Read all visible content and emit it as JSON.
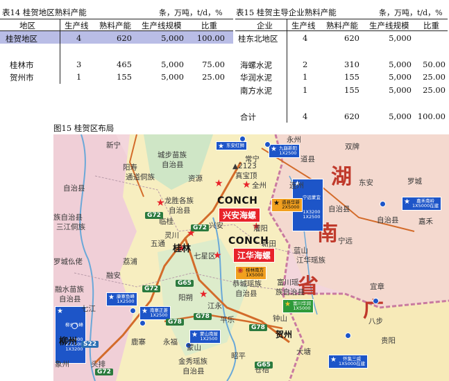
{
  "table14": {
    "title": "表14 桂贺地区熟料产能",
    "unit": "条，万吨，t/d，%",
    "headers": [
      "地区",
      "生产线",
      "熟料产能",
      "生产线规模",
      "比重"
    ],
    "rows": [
      [
        "桂贺地区",
        "4",
        "620",
        "5,000",
        "100.00"
      ],
      [
        "桂林市",
        "3",
        "465",
        "5,000",
        "75.00"
      ],
      [
        "贺州市",
        "1",
        "155",
        "5,000",
        "25.00"
      ]
    ]
  },
  "table15": {
    "title": "表15 桂贺主导企业熟料产能",
    "unit": "条，万吨，t/d，%",
    "headers": [
      "企业",
      "生产线",
      "熟料产能",
      "生产线规模",
      "比重"
    ],
    "rows": [
      [
        "桂东北地区",
        "4",
        "620",
        "5,000",
        ""
      ],
      [
        "海螺水泥",
        "2",
        "310",
        "5,000",
        "50.00"
      ],
      [
        "华润水泥",
        "1",
        "155",
        "5,000",
        "25.00"
      ],
      [
        "南方水泥",
        "1",
        "155",
        "5,000",
        "25.00"
      ],
      [
        "合计",
        "4",
        "620",
        "5,000",
        "100.00"
      ]
    ]
  },
  "figure": {
    "title": "图15 桂贺区布局",
    "province_labels": [
      "湖",
      "南",
      "省",
      "广"
    ],
    "conch_logo_text": [
      "CONCH",
      "CONCH"
    ],
    "plant_labels_red": [
      "兴安海螺",
      "江华海螺"
    ],
    "blue_boxes": [
      {
        "name": "东安红狮",
        "cap": ""
      },
      {
        "name": "九嶷新阳",
        "cap": "1X2500"
      },
      {
        "name": "宁远蒙宜",
        "cap": "1X3200\n1X2500"
      },
      {
        "name": "嘉禾南岭",
        "cap": "1X5000在建"
      },
      {
        "name": "康寨鱼峰",
        "cap": "1X2500"
      },
      {
        "name": "南寨正菱",
        "cap": "1X2500"
      },
      {
        "name": "柳州鱼峰",
        "cap": "1X2000\n2X2500\n1X3200"
      },
      {
        "name": "蒙山南屋",
        "cap": "1X2500"
      },
      {
        "name": "怀集三威",
        "cap": "1X5000在建"
      }
    ],
    "orange_boxes": [
      {
        "name": "道县华新",
        "cap": "2X5000"
      }
    ],
    "green_boxes": [
      {
        "name": "富川华润",
        "cap": "1X5000"
      }
    ],
    "orange_circle_box": {
      "name": "桂林南方",
      "cap": "1X5000"
    },
    "map_labels": [
      "永州",
      "城步苗族",
      "自治县",
      "资源",
      "全州",
      "新宁",
      "龙胜各族",
      "自治县",
      "兴安",
      "灌阳",
      "临桂",
      "灵川",
      "桂林",
      "五通",
      "七星区",
      "阳朔",
      "恭城瑶族",
      "自治县",
      "富川瑶",
      "族自治县",
      "钟山",
      "贺州",
      "昭平",
      "平乐",
      "苍梧",
      "蒙山",
      "金秀瑶族",
      "自治县",
      "融安",
      "融水苗族",
      "自治县",
      "柳州",
      "鹿寨",
      "罗城仫佬",
      "族自治县",
      "三江侗族",
      "自治县",
      "宁远",
      "蓝山",
      "江华瑶族",
      "自治县",
      "嘉禾",
      "宜章",
      "连州",
      "道县",
      "双牌",
      "常宁",
      "东安",
      "新田",
      "江永",
      "荔浦",
      "永福",
      "头排",
      "象州",
      "大塘",
      "八步",
      "阳寿",
      "通道侗族",
      "自治县",
      "贵阳",
      "七江",
      "罗城",
      "沙子"
    ],
    "road_labels": [
      "G72",
      "G72",
      "G65",
      "G72",
      "G78",
      "G78",
      "G78",
      "G65",
      "G72",
      "S22"
    ],
    "peak_label": "▲2123",
    "peak_name": "真宝顶"
  },
  "colors": {
    "header_highlight": "#b9bde6",
    "map_yellow": "#f7eec0",
    "map_pink": "#f3d6dc",
    "map_green": "#cfe6c6",
    "red": "#e8232a",
    "blue": "#1d55c8"
  }
}
